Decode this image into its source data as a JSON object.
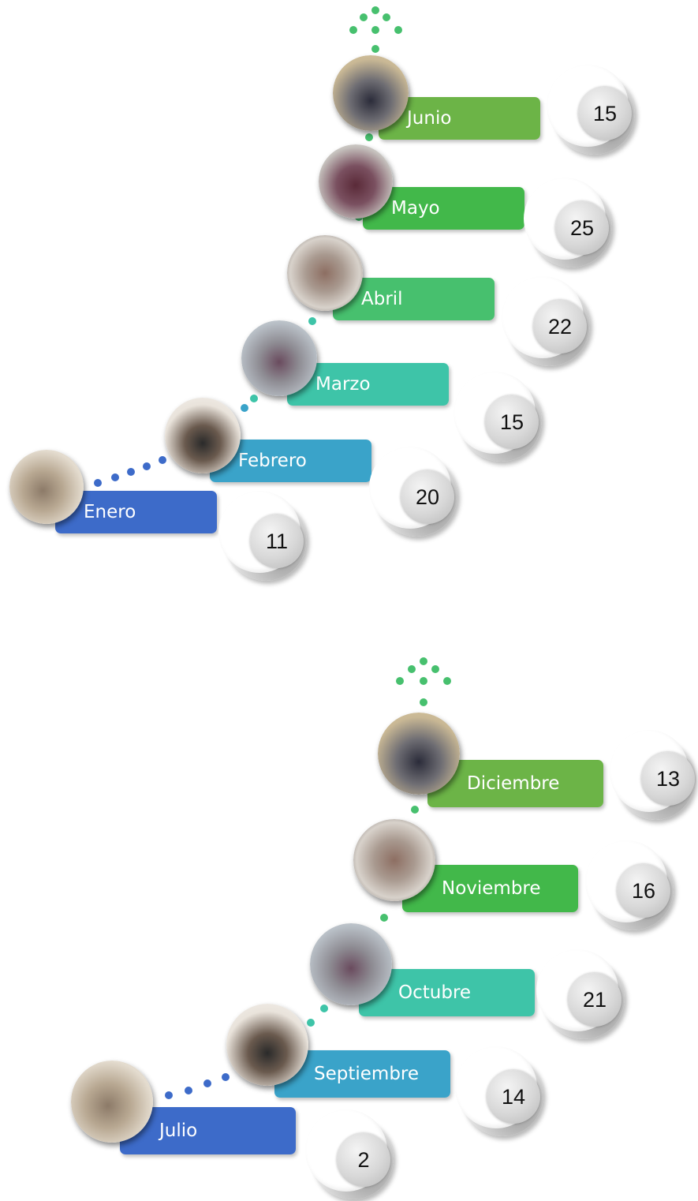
{
  "groups": [
    {
      "months": [
        {
          "label": "Enero",
          "count": "11",
          "color": "#3d6bc9"
        },
        {
          "label": "Febrero",
          "count": "20",
          "color": "#3aa3c9"
        },
        {
          "label": "Marzo",
          "count": "15",
          "color": "#3ec4a8"
        },
        {
          "label": "Abril",
          "count": "22",
          "color": "#47c06e"
        },
        {
          "label": "Mayo",
          "count": "25",
          "color": "#42b84a"
        },
        {
          "label": "Junio",
          "count": "15",
          "color": "#6cb447"
        }
      ]
    },
    {
      "months": [
        {
          "label": "Julio",
          "count": "2",
          "color": "#3d6bc9"
        },
        {
          "label": "Septiembre",
          "count": "14",
          "color": "#3aa3c9"
        },
        {
          "label": "Octubre",
          "count": "21",
          "color": "#3ec4a8"
        },
        {
          "label": "Noviembre",
          "count": "16",
          "color": "#42b84a"
        },
        {
          "label": "Diciembre",
          "count": "13",
          "color": "#6cb447"
        }
      ]
    }
  ]
}
